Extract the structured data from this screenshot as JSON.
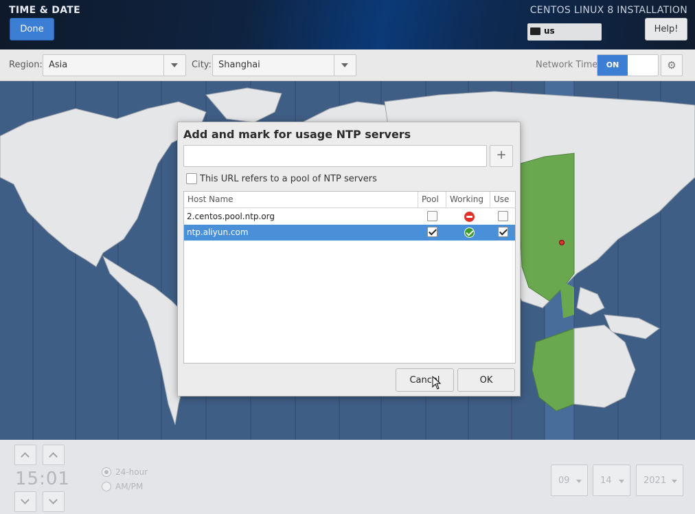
{
  "header": {
    "title": "TIME & DATE",
    "done_label": "Done",
    "install_title": "CENTOS LINUX 8 INSTALLATION",
    "keyboard_layout": "us",
    "help_label": "Help!"
  },
  "region_bar": {
    "region_label": "Region:",
    "region_value": "Asia",
    "city_label": "City:",
    "city_value": "Shanghai",
    "network_time_label": "Network Time",
    "network_time_state": "ON"
  },
  "dialog": {
    "title": "Add and mark for usage NTP servers",
    "input_value": "",
    "add_icon": "plus-icon",
    "pool_checkbox_label": "This URL refers to a pool of NTP servers",
    "columns": [
      "Host Name",
      "Pool",
      "Working",
      "Use"
    ],
    "rows": [
      {
        "host": "2.centos.pool.ntp.org",
        "pool": false,
        "working": false,
        "use": false,
        "selected": false
      },
      {
        "host": "ntp.aliyun.com",
        "pool": true,
        "working": true,
        "use": true,
        "selected": true
      }
    ],
    "cancel_label": "Cancel",
    "ok_label": "OK"
  },
  "time": {
    "clock": "15:01",
    "format_24h_label": "24-hour",
    "format_ampm_label": "AM/PM",
    "selected_format": "24-hour"
  },
  "date": {
    "month": "09",
    "day": "14",
    "year": "2021"
  },
  "colors": {
    "accent": "#3b7ed3",
    "selection": "#4a90d9",
    "map_ocean": "#3f5e85",
    "selected_zone": "#6aa84f"
  }
}
